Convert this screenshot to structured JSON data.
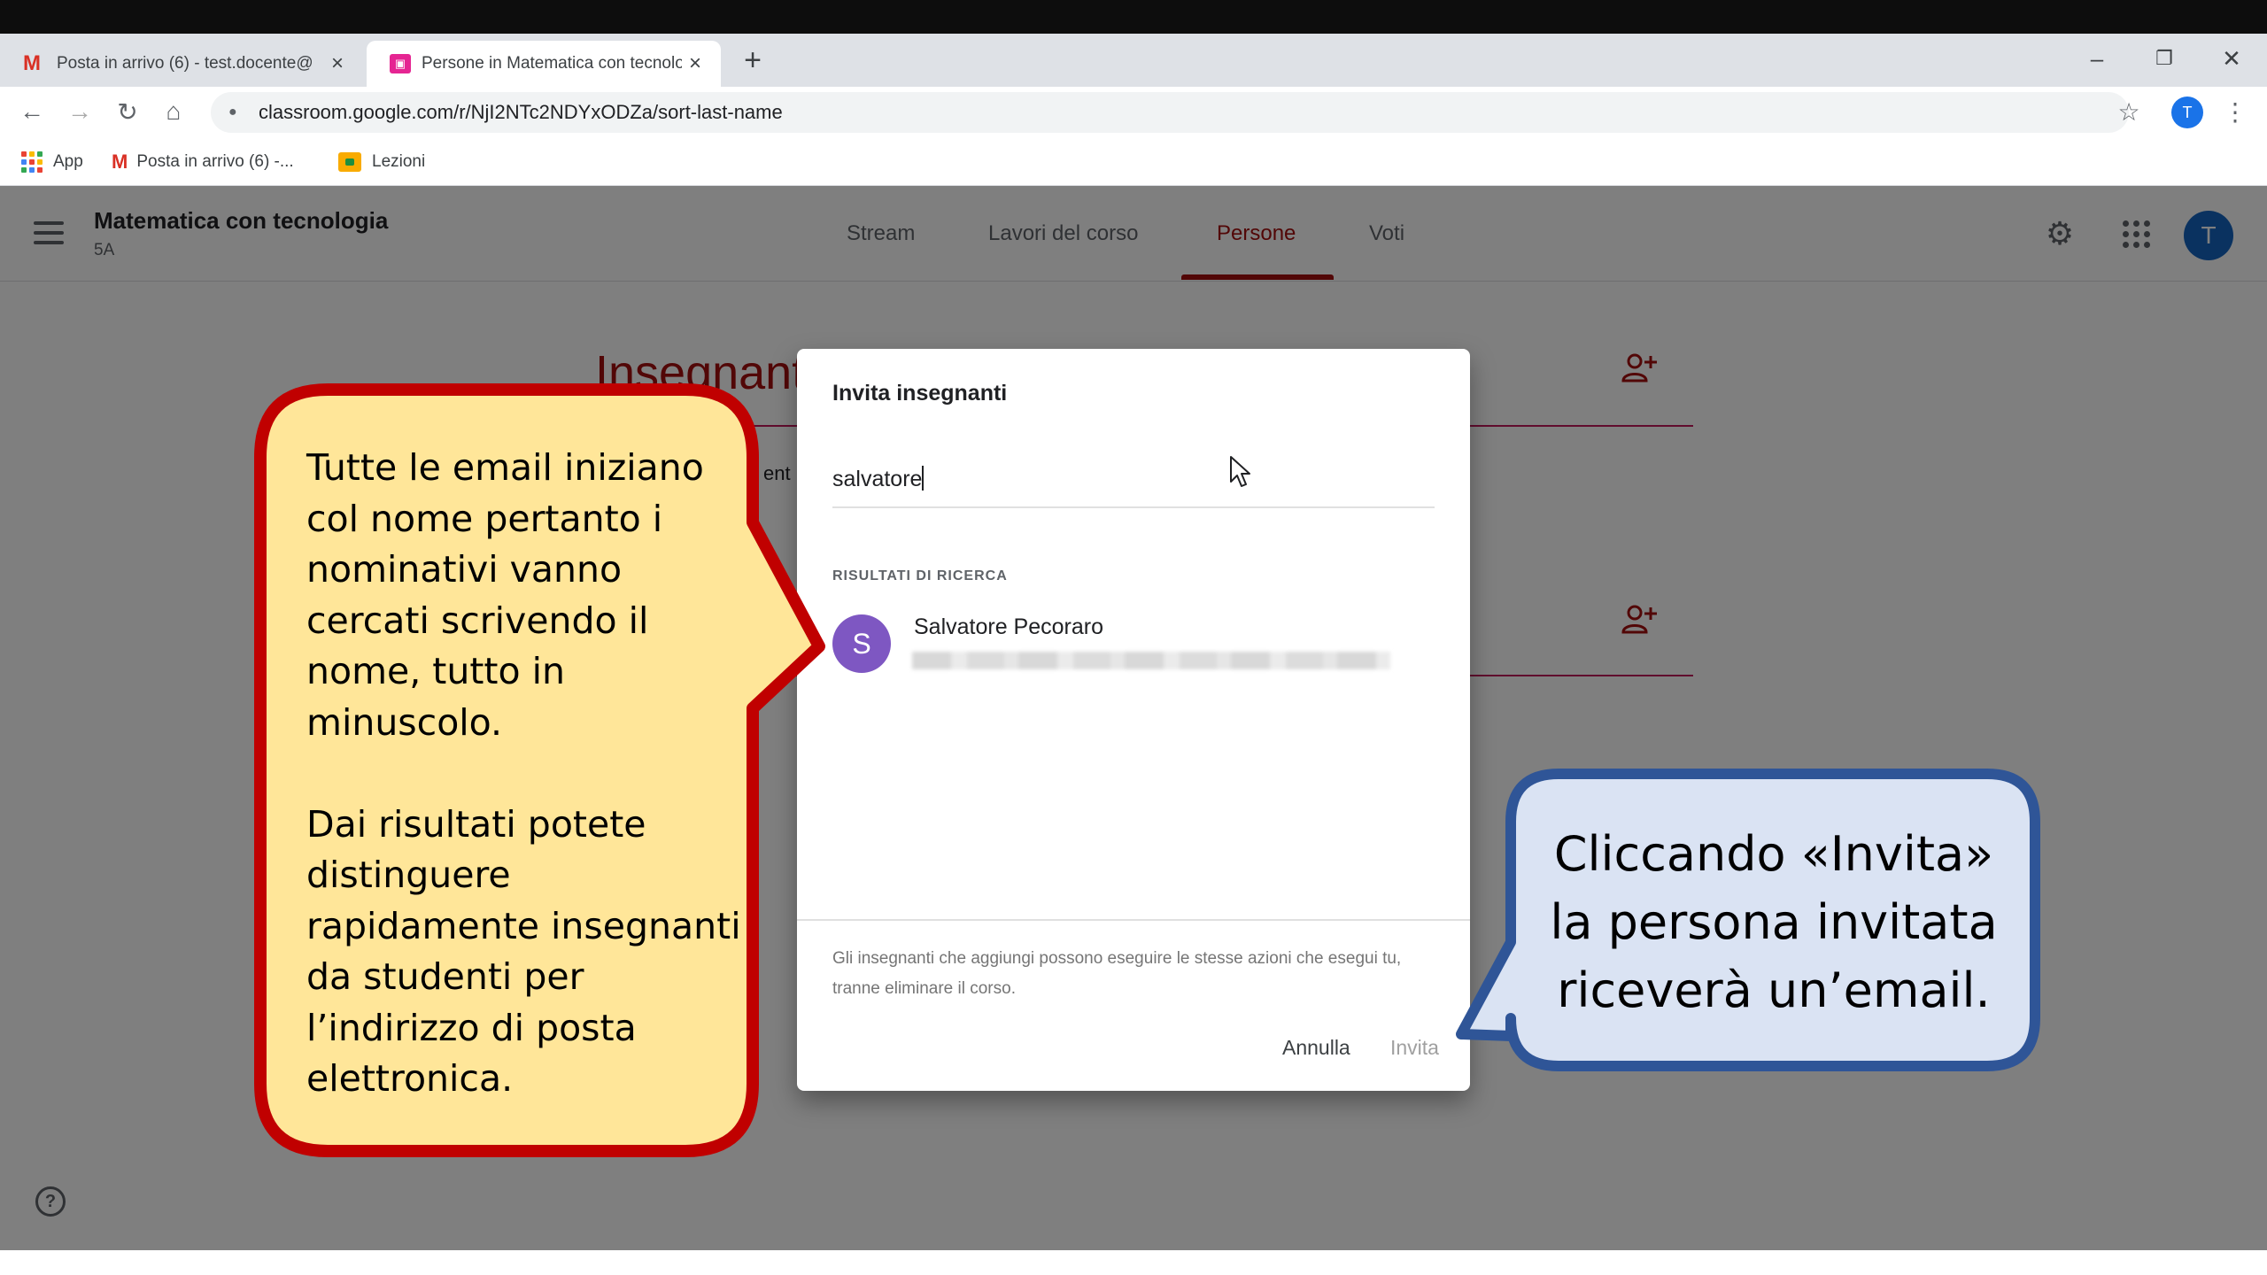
{
  "browser": {
    "tabs": [
      {
        "title": "Posta in arrivo (6) - test.docente@",
        "active": false,
        "favicon": "gmail-icon"
      },
      {
        "title": "Persone in Matematica con tecnologia",
        "active": true,
        "favicon": "classroom-icon"
      }
    ],
    "new_tab": "+",
    "window_controls": {
      "minimize": "–",
      "restore": "❐",
      "close": "✕"
    },
    "url": "classroom.google.com/r/NjI2NTc2NDYxODZa/sort-last-name",
    "profile_initial": "T",
    "bookmarks": [
      {
        "label": "App",
        "icon": "apps-grid-icon"
      },
      {
        "label": "Posta in arrivo (6) -...",
        "icon": "gmail-icon"
      },
      {
        "label": "Lezioni",
        "icon": "classroom-icon"
      }
    ]
  },
  "classroom": {
    "class_name": "Matematica con tecnologia",
    "section": "5A",
    "tabs": [
      "Stream",
      "Lavori del corso",
      "Persone",
      "Voti"
    ],
    "active_tab": "Persone",
    "avatar_initial": "T",
    "teachers_heading": "Insegnanti",
    "behind_text": "ent"
  },
  "dialog": {
    "title": "Invita insegnanti",
    "search_value": "salvatore",
    "results_label": "RISULTATI DI RICERCA",
    "result": {
      "initial": "S",
      "name": "Salvatore Pecoraro"
    },
    "note": "Gli insegnanti che aggiungi possono eseguire le stesse azioni che esegui tu, tranne eliminare il corso.",
    "cancel_label": "Annulla",
    "invite_label": "Invita"
  },
  "callouts": {
    "red": "Tutte le email iniziano col nome pertanto i nominativi vanno cercati scrivendo il nome, tutto in minuscolo.\n\nDai risultati potete distinguere rapidamente insegnanti da studenti per l’indirizzo di posta elettronica.",
    "blue": "Cliccando «Invita» la persona invitata riceverà un’email."
  },
  "colors": {
    "red_callout_border": "#c00000",
    "red_callout_fill": "#ffe699",
    "blue_callout_border": "#2f5597",
    "blue_callout_fill": "#dae3f3",
    "classroom_accent": "#a50e0e"
  }
}
